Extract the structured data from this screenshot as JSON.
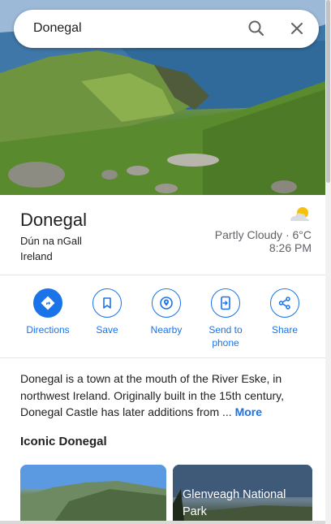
{
  "search": {
    "query": "Donegal"
  },
  "place": {
    "name": "Donegal",
    "irish_name": "Dún na nGall",
    "country": "Ireland"
  },
  "weather": {
    "condition_temp": "Partly Cloudy · 6°C",
    "time": "8:26 PM",
    "icon": "partly-cloudy-icon"
  },
  "actions": [
    {
      "label": "Directions",
      "icon": "directions-icon"
    },
    {
      "label": "Save",
      "icon": "bookmark-icon"
    },
    {
      "label": "Nearby",
      "icon": "nearby-icon"
    },
    {
      "label": "Send to\nphone",
      "icon": "send-to-phone-icon"
    },
    {
      "label": "Share",
      "icon": "share-icon"
    }
  ],
  "description": {
    "text": "Donegal is a town at the mouth of the River Eske, in northwest Ireland. Originally built in the 15th century, Donegal Castle has later additions from ...",
    "more_label": "More"
  },
  "iconic": {
    "title": "Iconic Donegal",
    "cards": [
      {
        "label": ""
      },
      {
        "label": "Glenveagh National Park"
      }
    ]
  },
  "colors": {
    "accent": "#1a73e8",
    "text": "#202124",
    "secondary": "#5f6368"
  }
}
